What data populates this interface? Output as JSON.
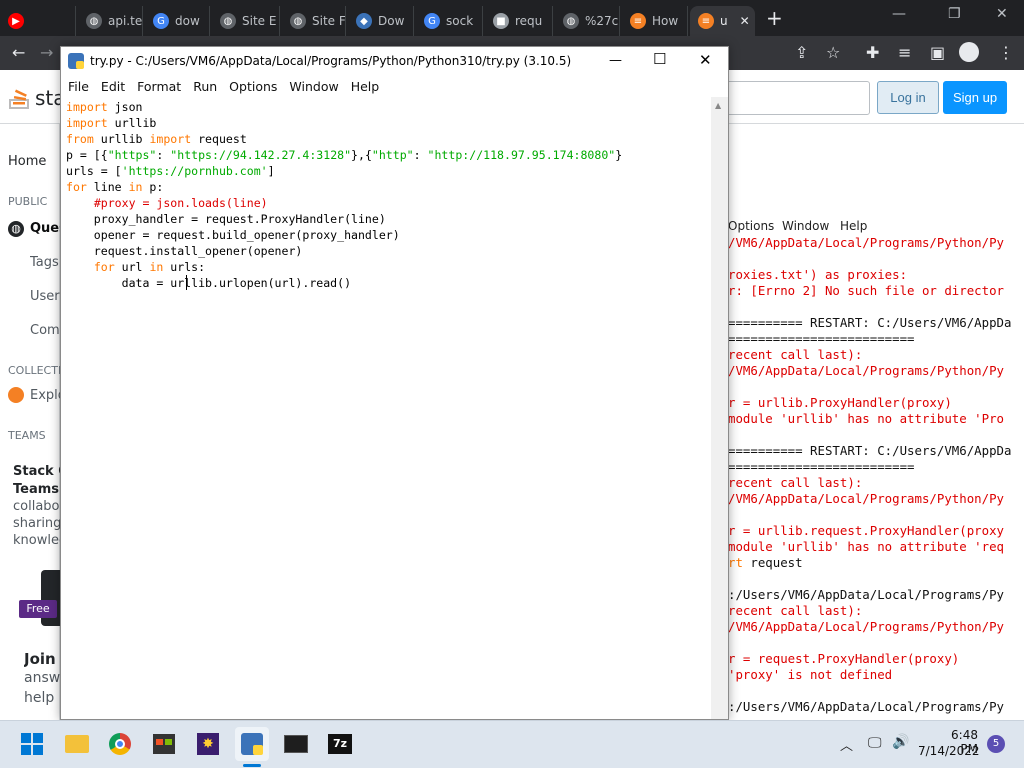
{
  "browser": {
    "tabs": [
      {
        "label": "",
        "icon": "youtube-icon"
      },
      {
        "label": "api.te",
        "icon": "globe-icon"
      },
      {
        "label": "dow",
        "icon": "google-icon"
      },
      {
        "label": "Site E",
        "icon": "globe-icon"
      },
      {
        "label": "Site F",
        "icon": "globe-icon"
      },
      {
        "label": "Dow",
        "icon": "python-icon"
      },
      {
        "label": "sock",
        "icon": "google-icon"
      },
      {
        "label": "requ",
        "icon": "cube-icon"
      },
      {
        "label": "%27c",
        "icon": "globe-icon"
      },
      {
        "label": "How",
        "icon": "stackoverflow-icon"
      },
      {
        "label": "u",
        "icon": "stackoverflow-icon"
      }
    ],
    "new_tab": "+",
    "close_tab": "✕"
  },
  "so": {
    "logo": "sta",
    "login": "Log in",
    "signup": "Sign up",
    "sidebar": {
      "home": "Home",
      "public": "PUBLIC",
      "questions": "Ques",
      "tags": "Tags",
      "users": "Users",
      "companies": "Comp",
      "collectives": "COLLECTIV",
      "explore": "Explo",
      "teams": "TEAMS"
    },
    "promo": {
      "title_a": "Stack O",
      "title_b": "Teams",
      "line1": "collabor",
      "line2": "sharing",
      "line3": "knowled",
      "free": "Free"
    },
    "join": {
      "title": "Join S",
      "line1": "answ",
      "line2": "help"
    }
  },
  "shell": {
    "menu": [
      "Options",
      "Window",
      "Help"
    ],
    "lines": [
      {
        "t": "/VM6/AppData/Local/Programs/Python/Py",
        "c": "red"
      },
      {
        "t": "",
        "c": "red"
      },
      {
        "t": "roxies.txt') as proxies:",
        "c": "red"
      },
      {
        "t": "r: [Errno 2] No such file or director",
        "c": "red"
      },
      {
        "t": "",
        "c": "red"
      },
      {
        "t": "========== RESTART: C:/Users/VM6/AppDa",
        "c": "black"
      },
      {
        "t": "=========================",
        "c": "black"
      },
      {
        "t": "recent call last):",
        "c": "red"
      },
      {
        "t": "/VM6/AppData/Local/Programs/Python/Py",
        "c": "red"
      },
      {
        "t": "",
        "c": "red"
      },
      {
        "t": "r = urllib.ProxyHandler(proxy)",
        "c": "red"
      },
      {
        "t": "module 'urllib' has no attribute 'Pro",
        "c": "red"
      },
      {
        "t": "",
        "c": "red"
      },
      {
        "t": "========== RESTART: C:/Users/VM6/AppDa",
        "c": "black"
      },
      {
        "t": "=========================",
        "c": "black"
      },
      {
        "t": "recent call last):",
        "c": "red"
      },
      {
        "t": "/VM6/AppData/Local/Programs/Python/Py",
        "c": "red"
      },
      {
        "t": "",
        "c": "red"
      },
      {
        "t": "r = urllib.request.ProxyHandler(proxy",
        "c": "red"
      },
      {
        "t": "module 'urllib' has no attribute 'req",
        "c": "red"
      },
      {
        "t": "rt request",
        "c": "mixed"
      },
      {
        "t": "",
        "c": "red"
      },
      {
        "t": ":/Users/VM6/AppData/Local/Programs/Py",
        "c": "black"
      },
      {
        "t": "recent call last):",
        "c": "red"
      },
      {
        "t": "/VM6/AppData/Local/Programs/Python/Py",
        "c": "red"
      },
      {
        "t": "",
        "c": "red"
      },
      {
        "t": "r = request.ProxyHandler(proxy)",
        "c": "red"
      },
      {
        "t": "'proxy' is not defined",
        "c": "red"
      },
      {
        "t": "",
        "c": "red"
      },
      {
        "t": ":/Users/VM6/AppData/Local/Programs/Py",
        "c": "black"
      }
    ]
  },
  "idle": {
    "title": "try.py - C:/Users/VM6/AppData/Local/Programs/Python/Python310/try.py (3.10.5)",
    "menu": [
      "File",
      "Edit",
      "Format",
      "Run",
      "Options",
      "Window",
      "Help"
    ],
    "code": [
      [
        [
          "import",
          "kw"
        ],
        [
          " json",
          "df"
        ]
      ],
      [
        [
          "import",
          "kw"
        ],
        [
          " urllib",
          "df"
        ]
      ],
      [
        [
          "from",
          "kw"
        ],
        [
          " urllib ",
          "df"
        ],
        [
          "import",
          "kw"
        ],
        [
          " request",
          "df"
        ]
      ],
      [
        [
          "p = [{",
          "df"
        ],
        [
          "\"https\"",
          "str"
        ],
        [
          ": ",
          "df"
        ],
        [
          "\"https://94.142.27.4:3128\"",
          "str"
        ],
        [
          "},{",
          "df"
        ],
        [
          "\"http\"",
          "str"
        ],
        [
          ": ",
          "df"
        ],
        [
          "\"http://118.97.95.174:8080\"",
          "str"
        ],
        [
          "}",
          "df"
        ]
      ],
      [
        [
          "urls = [",
          "df"
        ],
        [
          "'https://pornhub.com'",
          "str"
        ],
        [
          "]",
          "df"
        ]
      ],
      [
        [
          "for",
          "kw"
        ],
        [
          " line ",
          "df"
        ],
        [
          "in",
          "kw"
        ],
        [
          " p:",
          "df"
        ]
      ],
      [
        [
          "    ",
          "df"
        ],
        [
          "#proxy = json.loads(line)",
          "cm"
        ]
      ],
      [
        [
          "    proxy_handler = request.ProxyHandler(line)",
          "df"
        ]
      ],
      [
        [
          "    opener = request.build_opener(proxy_handler)",
          "df"
        ]
      ],
      [
        [
          "    request.install_opener(opener)",
          "df"
        ]
      ],
      [
        [
          "    ",
          "df"
        ],
        [
          "for",
          "kw"
        ],
        [
          " url ",
          "df"
        ],
        [
          "in",
          "kw"
        ],
        [
          " urls:",
          "df"
        ]
      ],
      [
        [
          "        data = urllib.urlopen(url).read()",
          "df"
        ]
      ]
    ]
  },
  "taskbar": {
    "time": "6:48 PM",
    "date": "7/14/2022",
    "notifications": "5"
  },
  "colors": {
    "keyword": "#ff7700",
    "string": "#00aa00",
    "comment": "#dd0000",
    "shell_error": "#dd0000",
    "so_blue": "#0a95ff",
    "chrome_dark": "#202124"
  }
}
